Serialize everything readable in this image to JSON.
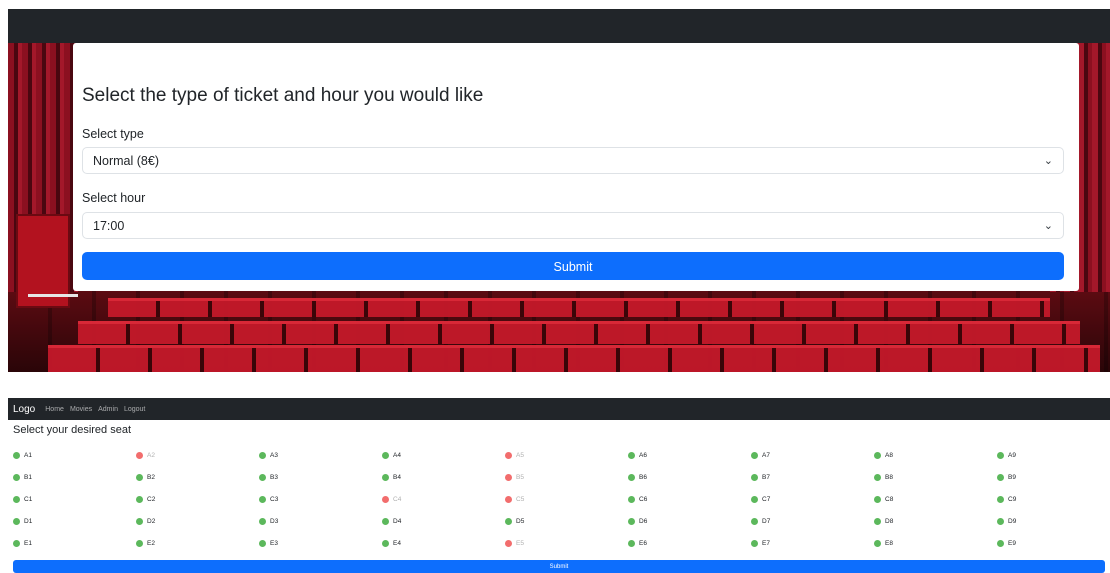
{
  "ticket_form": {
    "heading": "Select the type of ticket and hour you would like",
    "type_label": "Select type",
    "type_value": "Normal (8€)",
    "hour_label": "Select hour",
    "hour_value": "17:00",
    "submit_label": "Submit"
  },
  "navbar": {
    "brand": "Logo",
    "links": [
      "Home",
      "Movies",
      "Admin",
      "Logout"
    ]
  },
  "seat_selection": {
    "title": "Select your desired seat",
    "submit_label": "Submit",
    "rows": [
      [
        "A1",
        "A2",
        "A3",
        "A4",
        "A5",
        "A6",
        "A7",
        "A8",
        "A9"
      ],
      [
        "B1",
        "B2",
        "B3",
        "B4",
        "B5",
        "B6",
        "B7",
        "B8",
        "B9"
      ],
      [
        "C1",
        "C2",
        "C3",
        "C4",
        "C5",
        "C6",
        "C7",
        "C8",
        "C9"
      ],
      [
        "D1",
        "D2",
        "D3",
        "D4",
        "D5",
        "D6",
        "D7",
        "D8",
        "D9"
      ],
      [
        "E1",
        "E2",
        "E3",
        "E4",
        "E5",
        "E6",
        "E7",
        "E8",
        "E9"
      ]
    ],
    "taken": [
      "A2",
      "A5",
      "B5",
      "C4",
      "C5",
      "E5"
    ],
    "colors": {
      "available": "#5cb85c",
      "taken": "#f26d6d"
    }
  }
}
